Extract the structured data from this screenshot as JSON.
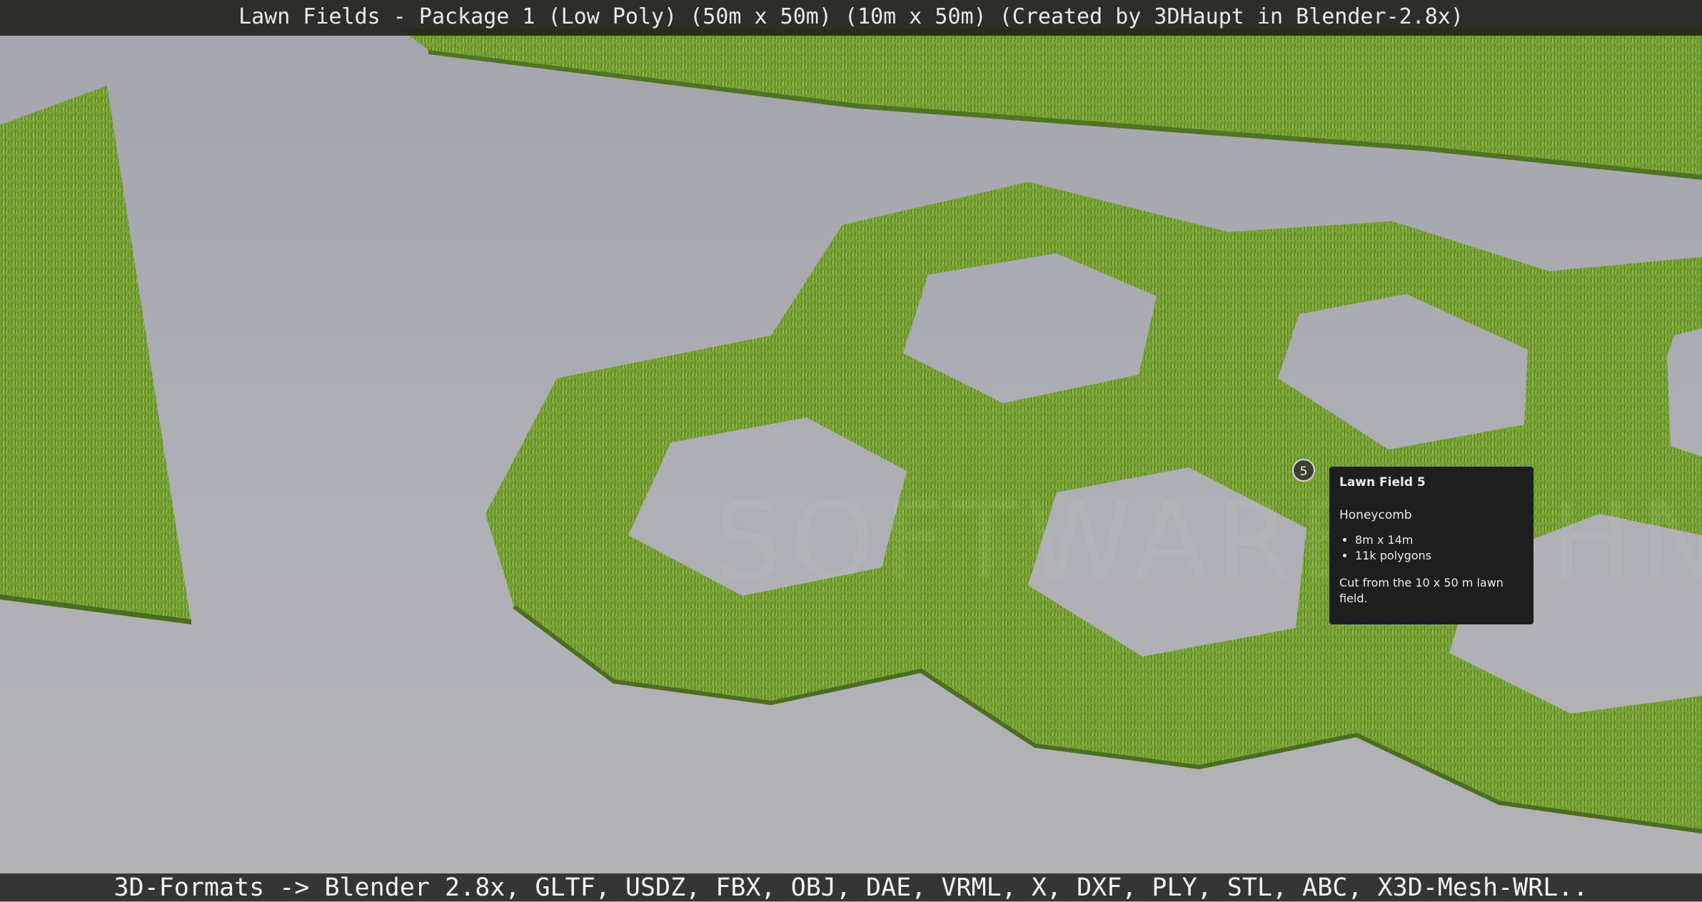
{
  "header": {
    "title": "Lawn Fields - Package 1 (Low Poly) (50m x 50m) (10m x 50m) (Created by 3DHaupt in Blender-2.8x)"
  },
  "footer": {
    "formats": "3D-Formats -> Blender 2.8x, GLTF, USDZ, FBX, OBJ, DAE, VRML, X, DXF, PLY, STL, ABC, X3D-Mesh-WRL.."
  },
  "annotation": {
    "number": "5",
    "title": "Lawn Field 5",
    "subtitle": "Honeycomb",
    "bullets": [
      "8m x 14m",
      "11k polygons"
    ],
    "description": "Cut from the 10 x 50 m lawn field."
  },
  "watermark": "SOFTWARE JOHN",
  "colors": {
    "grass": "#7fa83a",
    "grass_dark": "#5c8426",
    "background": "#a9aab1",
    "tooltip_bg": "#1e1e1e"
  }
}
